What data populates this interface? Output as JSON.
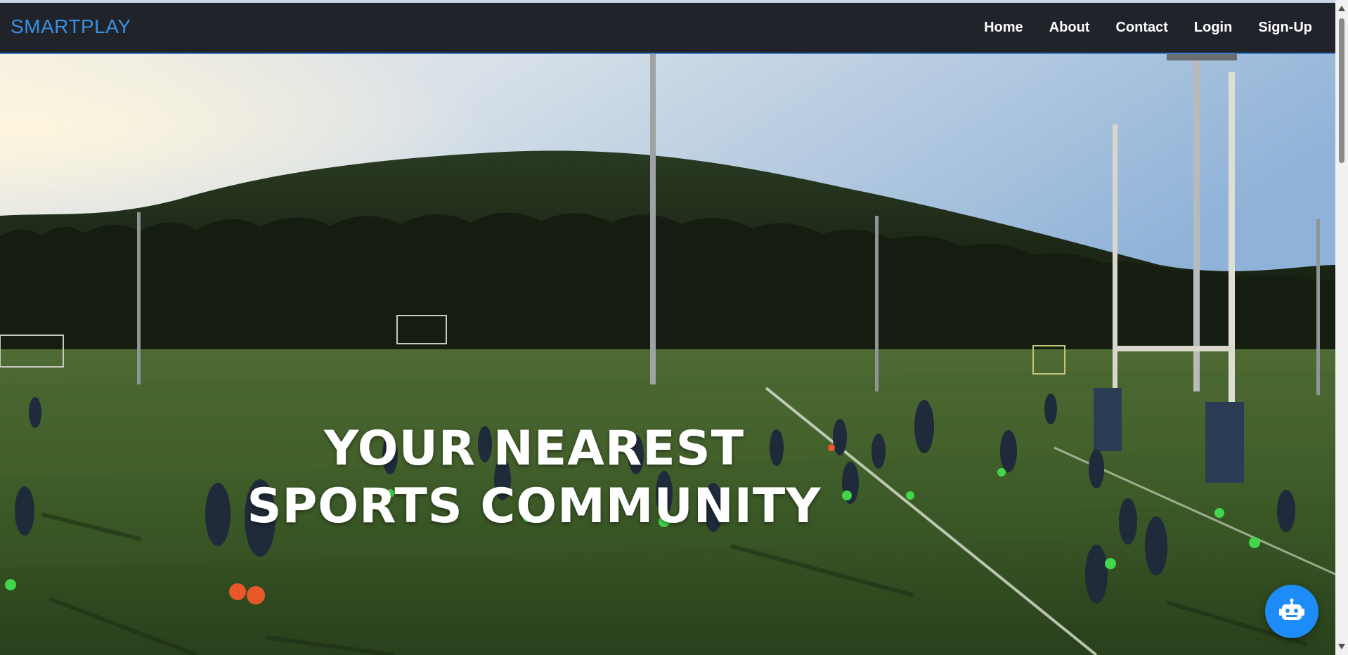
{
  "brand": {
    "name": "SMARTPLAY"
  },
  "nav": {
    "items": [
      {
        "label": "Home"
      },
      {
        "label": "About"
      },
      {
        "label": "Contact"
      },
      {
        "label": "Login"
      },
      {
        "label": "Sign-Up"
      }
    ]
  },
  "hero": {
    "title_line1": "YOUR NEAREST",
    "title_line2": "SPORTS COMMUNITY"
  },
  "chatbot": {
    "icon": "robot-icon"
  },
  "colors": {
    "navbar_bg": "#20232a",
    "brand": "#3b8fe0",
    "chat_button": "#1d8cf8",
    "nav_text": "#ffffff"
  }
}
